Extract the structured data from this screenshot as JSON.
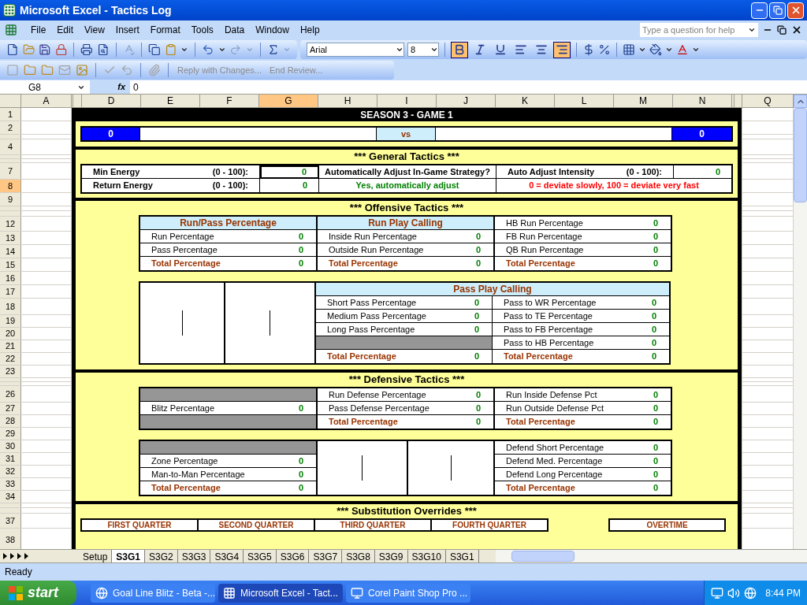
{
  "window": {
    "title": "Microsoft Excel - Tactics Log"
  },
  "menu": [
    "File",
    "Edit",
    "View",
    "Insert",
    "Format",
    "Tools",
    "Data",
    "Window",
    "Help"
  ],
  "help_box": {
    "placeholder": "Type a question for help"
  },
  "formatting": {
    "font": "Arial",
    "size": "8",
    "buttons": [
      {
        "kind": "bold",
        "selected": true
      },
      {
        "kind": "italic",
        "selected": false
      },
      {
        "kind": "underline",
        "selected": false
      },
      {
        "kind": "align-left",
        "selected": false
      },
      {
        "kind": "align-center",
        "selected": false
      },
      {
        "kind": "align-right",
        "selected": true
      }
    ]
  },
  "review_toolbar": [
    "Reply with Changes...",
    "End Review..."
  ],
  "formula_bar": {
    "name_box": "G8",
    "fx": "fx",
    "value": "0"
  },
  "columns": [
    {
      "label": "A",
      "selected": false
    },
    {
      "label": "D",
      "selected": false
    },
    {
      "label": "E",
      "selected": false
    },
    {
      "label": "F",
      "selected": false
    },
    {
      "label": "G",
      "selected": true
    },
    {
      "label": "H",
      "selected": false
    },
    {
      "label": "I",
      "selected": false
    },
    {
      "label": "J",
      "selected": false
    },
    {
      "label": "K",
      "selected": false
    },
    {
      "label": "L",
      "selected": false
    },
    {
      "label": "M",
      "selected": false
    },
    {
      "label": "N",
      "selected": false
    },
    {
      "label": "Q",
      "selected": false
    }
  ],
  "rows": [
    {
      "label": "1",
      "selected": false
    },
    {
      "label": "2",
      "selected": false
    },
    {
      "label": "4",
      "selected": false
    },
    {
      "label": "7",
      "selected": false
    },
    {
      "label": "8",
      "selected": true
    },
    {
      "label": "9",
      "selected": false
    },
    {
      "label": "12",
      "selected": false
    },
    {
      "label": "13",
      "selected": false
    },
    {
      "label": "14",
      "selected": false
    },
    {
      "label": "15",
      "selected": false
    },
    {
      "label": "16",
      "selected": false
    },
    {
      "label": "17",
      "selected": false
    },
    {
      "label": "18",
      "selected": false
    },
    {
      "label": "19",
      "selected": false
    },
    {
      "label": "20",
      "selected": false
    },
    {
      "label": "21",
      "selected": false
    },
    {
      "label": "22",
      "selected": false
    },
    {
      "label": "23",
      "selected": false
    },
    {
      "label": "26",
      "selected": false
    },
    {
      "label": "27",
      "selected": false
    },
    {
      "label": "28",
      "selected": false
    },
    {
      "label": "29",
      "selected": false
    },
    {
      "label": "30",
      "selected": false
    },
    {
      "label": "31",
      "selected": false
    },
    {
      "label": "32",
      "selected": false
    },
    {
      "label": "33",
      "selected": false
    },
    {
      "label": "34",
      "selected": false
    },
    {
      "label": "37",
      "selected": false
    },
    {
      "label": "38",
      "selected": false
    }
  ],
  "sheet": {
    "title": "SEASON 3 - GAME 1",
    "score": {
      "home": "0",
      "separator": "vs",
      "away": "0"
    },
    "general": {
      "title": "*** General Tactics ***",
      "min_energy": {
        "label": "Min Energy",
        "range": "(0 - 100):",
        "value": "0",
        "selected": true
      },
      "return_energy": {
        "label": "Return Energy",
        "range": "(0 - 100):",
        "value": "0",
        "selected": false
      },
      "strategy_question": "Automatically Adjust In-Game Strategy?",
      "strategy_answer": "Yes, automatically adjust",
      "intensity": {
        "label": "Auto Adjust Intensity",
        "range": "(0 - 100):",
        "value": "0",
        "selected": false
      },
      "intensity_note": "0 = deviate slowly, 100 = deviate very fast"
    },
    "offense": {
      "title": "*** Offensive Tactics ***",
      "tables": [
        {
          "rows": [
            {
              "kind": "header",
              "label": "Run/Pass Percentage"
            },
            {
              "kind": "item",
              "label": "Run Percentage",
              "value": "0"
            },
            {
              "kind": "item",
              "label": "Pass Percentage",
              "value": "0"
            },
            {
              "kind": "total",
              "label": "Total Percentage",
              "value": "0"
            }
          ]
        },
        {
          "rows": [
            {
              "kind": "header",
              "label": "Run Play Calling"
            },
            {
              "kind": "item",
              "label": "Inside Run Percentage",
              "value": "0"
            },
            {
              "kind": "item",
              "label": "Outside Run Percentage",
              "value": "0"
            },
            {
              "kind": "total",
              "label": "Total Percentage",
              "value": "0"
            }
          ]
        },
        {
          "rows": [
            {
              "kind": "item",
              "label": "HB Run Percentage",
              "value": "0"
            },
            {
              "kind": "item",
              "label": "FB Run Percentage",
              "value": "0"
            },
            {
              "kind": "item",
              "label": "QB Run Percentage",
              "value": "0"
            },
            {
              "kind": "total",
              "label": "Total Percentage",
              "value": "0"
            }
          ]
        }
      ],
      "pass_calling": {
        "header": "Pass Play Calling",
        "columns": [
          {
            "rows": [
              {
                "kind": "item",
                "label": "Short Pass Percentage",
                "value": "0"
              },
              {
                "kind": "item",
                "label": "Medium Pass Percentage",
                "value": "0"
              },
              {
                "kind": "item",
                "label": "Long Pass Percentage",
                "value": "0"
              },
              {
                "kind": "blank"
              },
              {
                "kind": "total",
                "label": "Total Percentage",
                "value": "0"
              }
            ]
          },
          {
            "rows": [
              {
                "kind": "item",
                "label": "Pass to WR Percentage",
                "value": "0"
              },
              {
                "kind": "item",
                "label": "Pass to TE Percentage",
                "value": "0"
              },
              {
                "kind": "item",
                "label": "Pass to FB Percentage",
                "value": "0"
              },
              {
                "kind": "item",
                "label": "Pass to HB Percentage",
                "value": "0"
              },
              {
                "kind": "total",
                "label": "Total Percentage",
                "value": "0"
              }
            ]
          }
        ]
      }
    },
    "defense": {
      "title": "*** Defensive Tactics ***",
      "tables": [
        {
          "rows": [
            {
              "kind": "blank"
            },
            {
              "kind": "item",
              "label": "Blitz Percentage",
              "value": "0"
            },
            {
              "kind": "blank"
            }
          ]
        },
        {
          "rows": [
            {
              "kind": "item",
              "label": "Run Defense Percentage",
              "value": "0"
            },
            {
              "kind": "item",
              "label": "Pass Defense Percentage",
              "value": "0"
            },
            {
              "kind": "total",
              "label": "Total Percentage",
              "value": "0"
            }
          ]
        },
        {
          "rows": [
            {
              "kind": "item",
              "label": "Run Inside Defense Pct",
              "value": "0"
            },
            {
              "kind": "item",
              "label": "Run Outside Defense Pct",
              "value": "0"
            },
            {
              "kind": "total",
              "label": "Total Percentage",
              "value": "0"
            }
          ]
        }
      ],
      "coverage": [
        {
          "rows": [
            {
              "kind": "blank"
            },
            {
              "kind": "item",
              "label": "Zone Percentage",
              "value": "0"
            },
            {
              "kind": "item",
              "label": "Man-to-Man Percentage",
              "value": "0"
            },
            {
              "kind": "total",
              "label": "Total Percentage",
              "value": "0"
            }
          ]
        },
        {
          "rows": [
            {
              "kind": "item",
              "label": "Defend Short Percentage",
              "value": "0"
            },
            {
              "kind": "item",
              "label": "Defend Med. Percentage",
              "value": "0"
            },
            {
              "kind": "item",
              "label": "Defend Long Percentage",
              "value": "0"
            },
            {
              "kind": "total",
              "label": "Total Percentage",
              "value": "0"
            }
          ]
        }
      ]
    },
    "substitution": {
      "title": "*** Substitution Overrides ***",
      "quarters": [
        "FIRST QUARTER",
        "SECOND QUARTER",
        "THIRD QUARTER",
        "FOURTH QUARTER"
      ],
      "overtime": "OVERTIME"
    }
  },
  "sheet_tabs": [
    {
      "label": "Setup",
      "selected": false
    },
    {
      "label": "S3G1",
      "selected": true
    },
    {
      "label": "S3G2",
      "selected": false
    },
    {
      "label": "S3G3",
      "selected": false
    },
    {
      "label": "S3G4",
      "selected": false
    },
    {
      "label": "S3G5",
      "selected": false
    },
    {
      "label": "S3G6",
      "selected": false
    },
    {
      "label": "S3G7",
      "selected": false
    },
    {
      "label": "S3G8",
      "selected": false
    },
    {
      "label": "S3G9",
      "selected": false
    },
    {
      "label": "S3G10",
      "selected": false
    },
    {
      "label": "S3G1",
      "selected": false
    }
  ],
  "status_bar": "Ready",
  "taskbar": {
    "start": "start",
    "tasks": [
      {
        "label": "Goal Line Blitz - Beta -...",
        "selected": false
      },
      {
        "label": "Microsoft Excel - Tact...",
        "selected": true
      },
      {
        "label": "Corel Paint Shop Pro ...",
        "selected": false
      }
    ],
    "clock": "8:44 PM"
  }
}
